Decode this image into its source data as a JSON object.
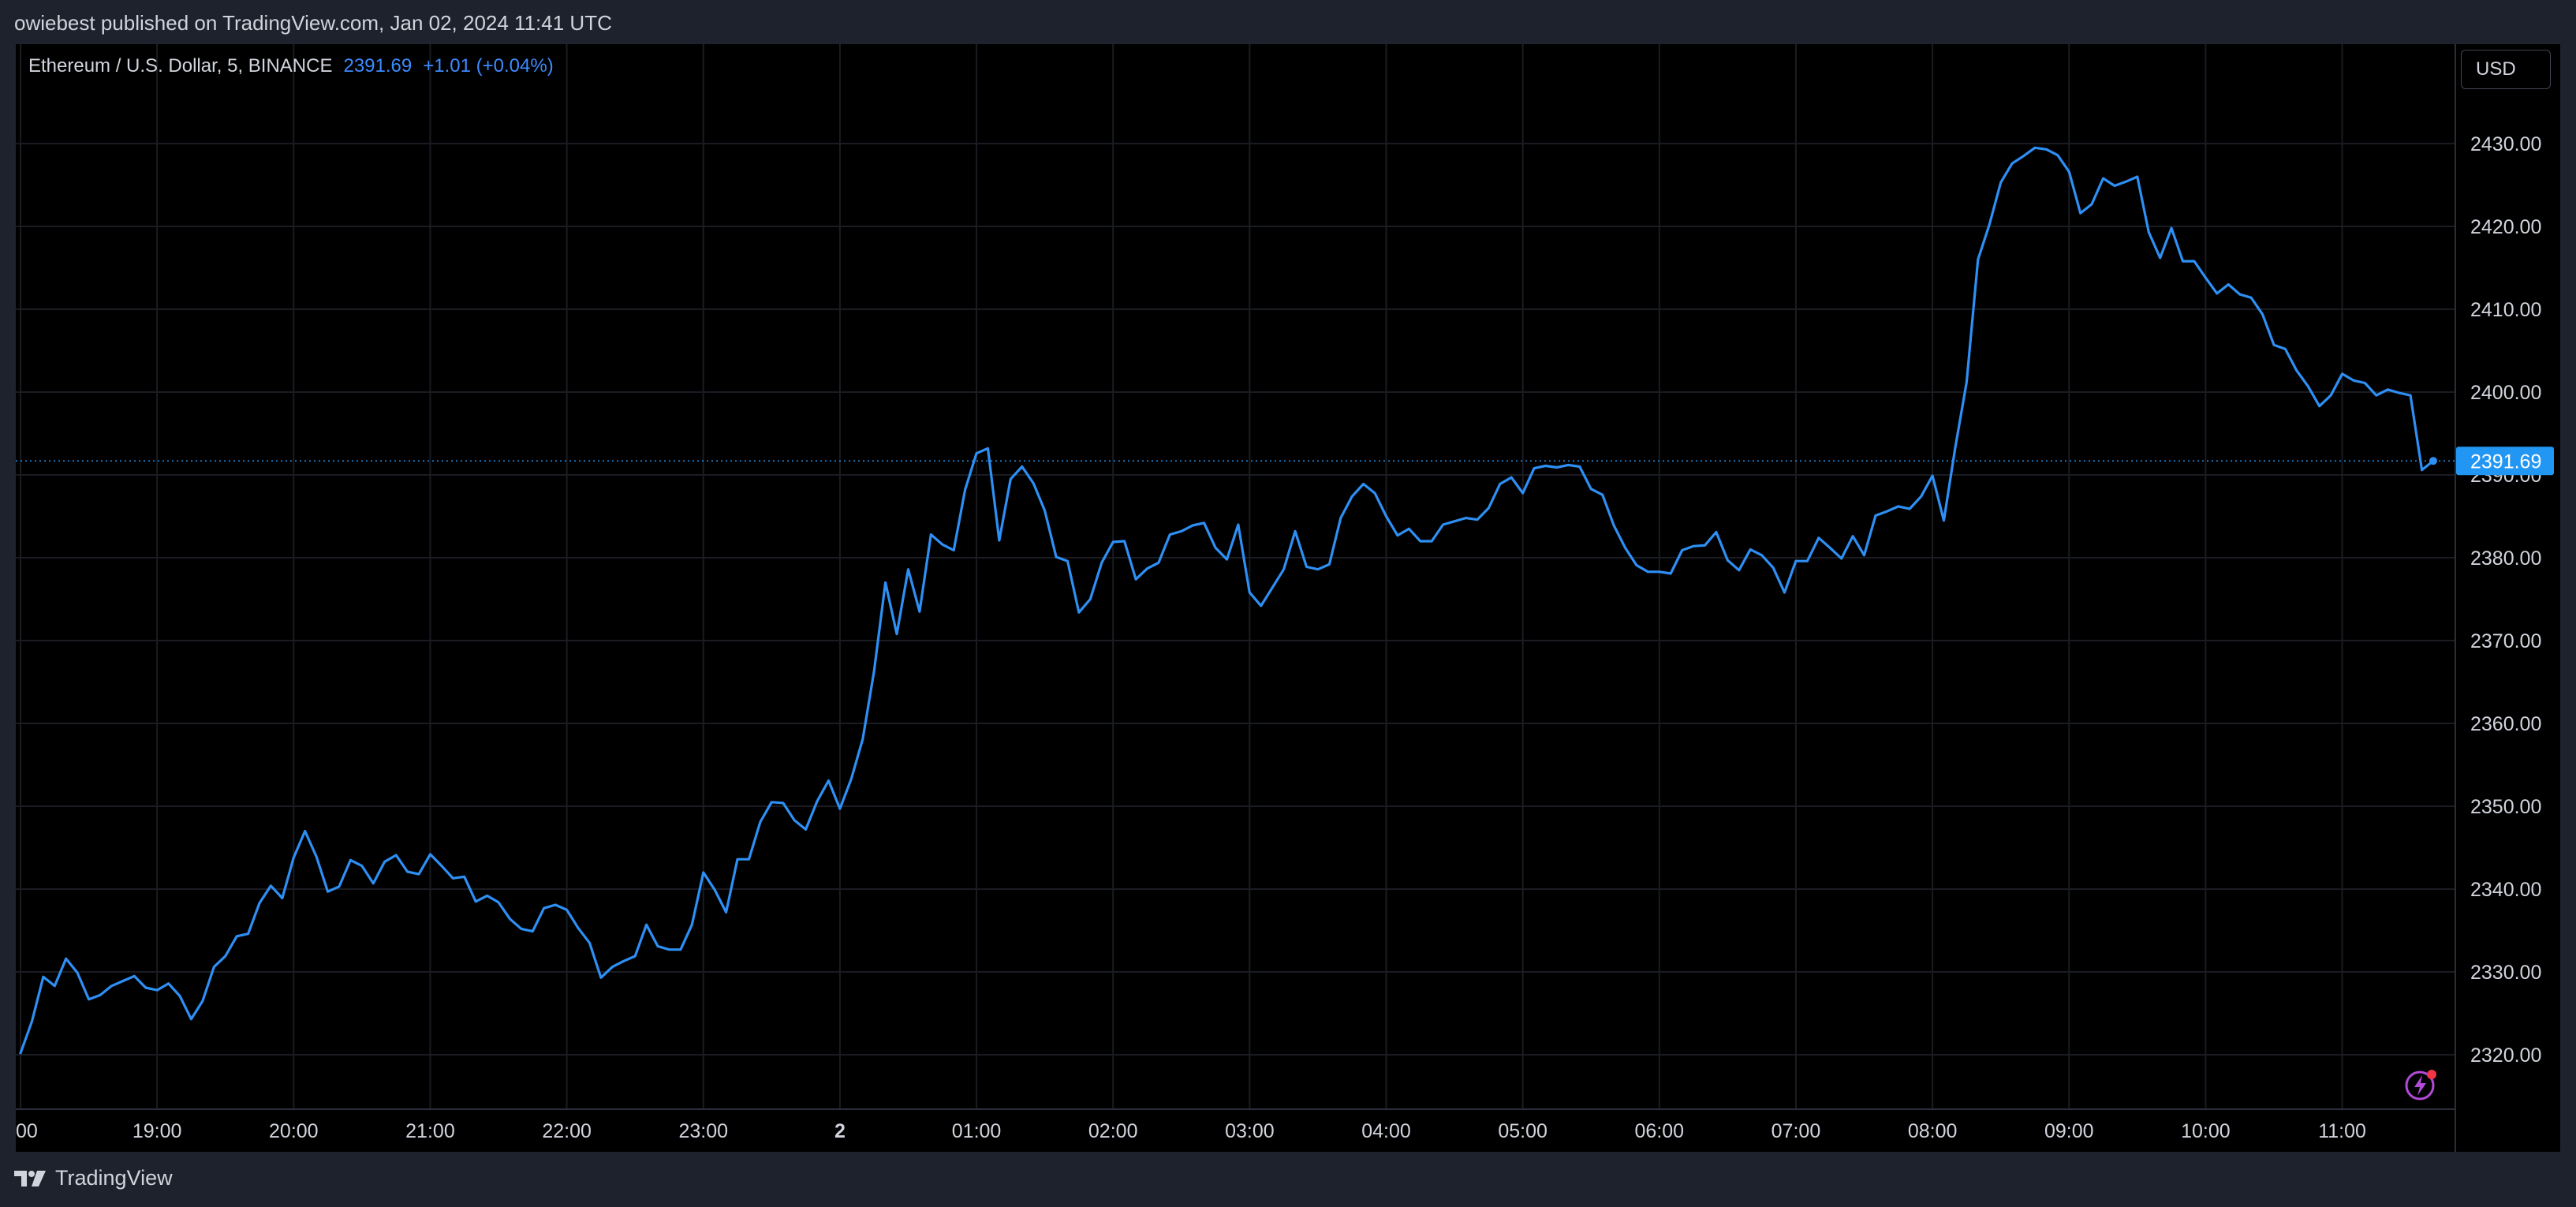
{
  "header": {
    "published_text": "owiebest published on TradingView.com, Jan 02, 2024 11:41 UTC"
  },
  "legend": {
    "symbol": "Ethereum / U.S. Dollar, 5, BINANCE",
    "last_price": "2391.69",
    "change": "+1.01 (+0.04%)"
  },
  "currency_button": {
    "label": "USD"
  },
  "price_badge": {
    "label": "2391.69"
  },
  "footer": {
    "brand": "TradingView"
  },
  "icons": {
    "logo": "tradingview-logo-icon",
    "bolt": "lightning-bolt-icon"
  },
  "colors": {
    "line": "#2e8ff4",
    "background": "#000000",
    "frame": "#1e222d",
    "grid": "#1a1c22",
    "accent_badge": "#2196f3",
    "bolt": "#b34bd9"
  },
  "chart_data": {
    "type": "line",
    "title": "",
    "xlabel": "",
    "ylabel": "",
    "ylim": [
      2313.4,
      2440.0
    ],
    "grid": true,
    "x_axis_ticks": [
      {
        "label": "00",
        "minute": 1080
      },
      {
        "label": "19:00",
        "minute": 1140
      },
      {
        "label": "20:00",
        "minute": 1200
      },
      {
        "label": "21:00",
        "minute": 1260
      },
      {
        "label": "22:00",
        "minute": 1320
      },
      {
        "label": "23:00",
        "minute": 1380
      },
      {
        "label": "2",
        "minute": 1440,
        "bold": true
      },
      {
        "label": "01:00",
        "minute": 1500
      },
      {
        "label": "02:00",
        "minute": 1560
      },
      {
        "label": "03:00",
        "minute": 1620
      },
      {
        "label": "04:00",
        "minute": 1680
      },
      {
        "label": "05:00",
        "minute": 1740
      },
      {
        "label": "06:00",
        "minute": 1800
      },
      {
        "label": "07:00",
        "minute": 1860
      },
      {
        "label": "08:00",
        "minute": 1920
      },
      {
        "label": "09:00",
        "minute": 1980
      },
      {
        "label": "10:00",
        "minute": 2040
      },
      {
        "label": "11:00",
        "minute": 2100
      }
    ],
    "y_axis_ticks": [
      "2320.00",
      "2330.00",
      "2340.00",
      "2350.00",
      "2360.00",
      "2370.00",
      "2380.00",
      "2390.00",
      "2400.00",
      "2410.00",
      "2420.00",
      "2430.00"
    ],
    "last_value": 2391.69,
    "series": [
      {
        "values": [
          2320.2,
          2324.0,
          2329.4,
          2328.3,
          2331.6,
          2329.9,
          2326.7,
          2327.2,
          2328.3,
          2328.9,
          2329.5,
          2328.1,
          2327.8,
          2328.6,
          2327.1,
          2324.3,
          2326.5,
          2330.6,
          2331.9,
          2334.3,
          2334.6,
          2338.3,
          2340.4,
          2338.9,
          2343.8,
          2347.0,
          2343.9,
          2339.7,
          2340.3,
          2343.5,
          2342.8,
          2340.7,
          2343.3,
          2344.1,
          2342.1,
          2341.8,
          2344.2,
          2342.8,
          2341.3,
          2341.5,
          2338.5,
          2339.2,
          2338.4,
          2336.4,
          2335.2,
          2334.9,
          2337.7,
          2338.1,
          2337.5,
          2335.3,
          2333.5,
          2329.3,
          2330.6,
          2331.3,
          2331.9,
          2335.7,
          2333.1,
          2332.7,
          2332.7,
          2335.7,
          2342.0,
          2339.9,
          2337.2,
          2343.6,
          2343.6,
          2348.1,
          2350.5,
          2350.4,
          2348.3,
          2347.2,
          2350.6,
          2353.1,
          2349.7,
          2353.3,
          2358.1,
          2366.3,
          2377.0,
          2370.8,
          2378.6,
          2373.5,
          2382.8,
          2381.6,
          2380.9,
          2388.2,
          2392.6,
          2393.2,
          2382.1,
          2389.5,
          2391.0,
          2389.0,
          2385.7,
          2380.1,
          2379.6,
          2373.4,
          2375.0,
          2379.4,
          2381.9,
          2382.0,
          2377.4,
          2378.7,
          2379.4,
          2382.8,
          2383.2,
          2383.9,
          2384.2,
          2381.2,
          2379.8,
          2384.0,
          2375.8,
          2374.2,
          2376.4,
          2378.6,
          2383.2,
          2378.9,
          2378.6,
          2379.2,
          2384.8,
          2387.4,
          2388.9,
          2387.8,
          2385.0,
          2382.7,
          2383.5,
          2382.0,
          2382.0,
          2384.0,
          2384.4,
          2384.8,
          2384.6,
          2386.0,
          2388.9,
          2389.7,
          2387.8,
          2390.8,
          2391.1,
          2390.9,
          2391.2,
          2391.0,
          2388.3,
          2387.6,
          2383.9,
          2381.2,
          2379.1,
          2378.3,
          2378.3,
          2378.1,
          2380.9,
          2381.4,
          2381.5,
          2383.1,
          2379.7,
          2378.5,
          2381.0,
          2380.3,
          2378.8,
          2375.8,
          2379.6,
          2379.6,
          2382.4,
          2381.2,
          2379.9,
          2382.6,
          2380.3,
          2385.1,
          2385.6,
          2386.2,
          2385.9,
          2387.4,
          2389.9,
          2384.5,
          2393.3,
          2401.2,
          2416.0,
          2420.2,
          2425.3,
          2427.6,
          2428.5,
          2429.5,
          2429.3,
          2428.6,
          2426.6,
          2421.6,
          2422.7,
          2425.8,
          2424.9,
          2425.4,
          2426.0,
          2419.3,
          2416.2,
          2419.8,
          2415.8,
          2415.8,
          2413.8,
          2411.9,
          2413.0,
          2411.8,
          2411.4,
          2409.4,
          2405.7,
          2405.2,
          2402.6,
          2400.7,
          2398.3,
          2399.6,
          2402.2,
          2401.4,
          2401.1,
          2399.6,
          2400.3,
          2399.9,
          2399.6,
          2390.6,
          2391.69
        ]
      }
    ]
  }
}
